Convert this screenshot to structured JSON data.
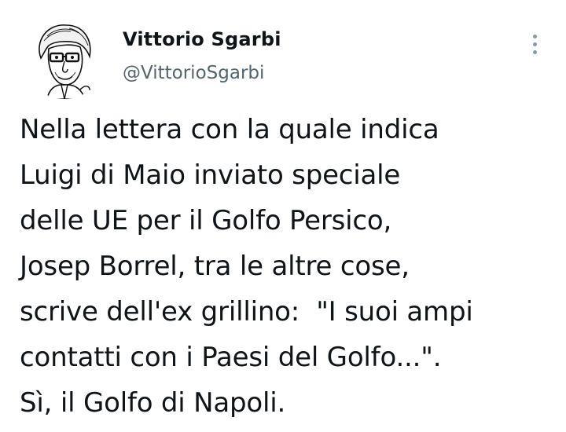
{
  "author": {
    "display_name": "Vittorio Sgarbi",
    "handle": "@VittorioSgarbi",
    "avatar_icon": "caricature-portrait-icon"
  },
  "menu": {
    "icon": "more-options-icon"
  },
  "tweet": {
    "lines": [
      "Nella lettera con la quale indica",
      "Luigi di Maio inviato speciale",
      "delle UE per il Golfo Persico,",
      "Josep Borrel, tra le altre cose,",
      "scrive dell'ex grillino:  \"I suoi ampi",
      "contatti con i Paesi del Golfo...\".",
      "Sì, il Golfo di Napoli."
    ]
  },
  "colors": {
    "text": "#0f1419",
    "secondary": "#536471",
    "menu_dots": "#8b98a5"
  }
}
